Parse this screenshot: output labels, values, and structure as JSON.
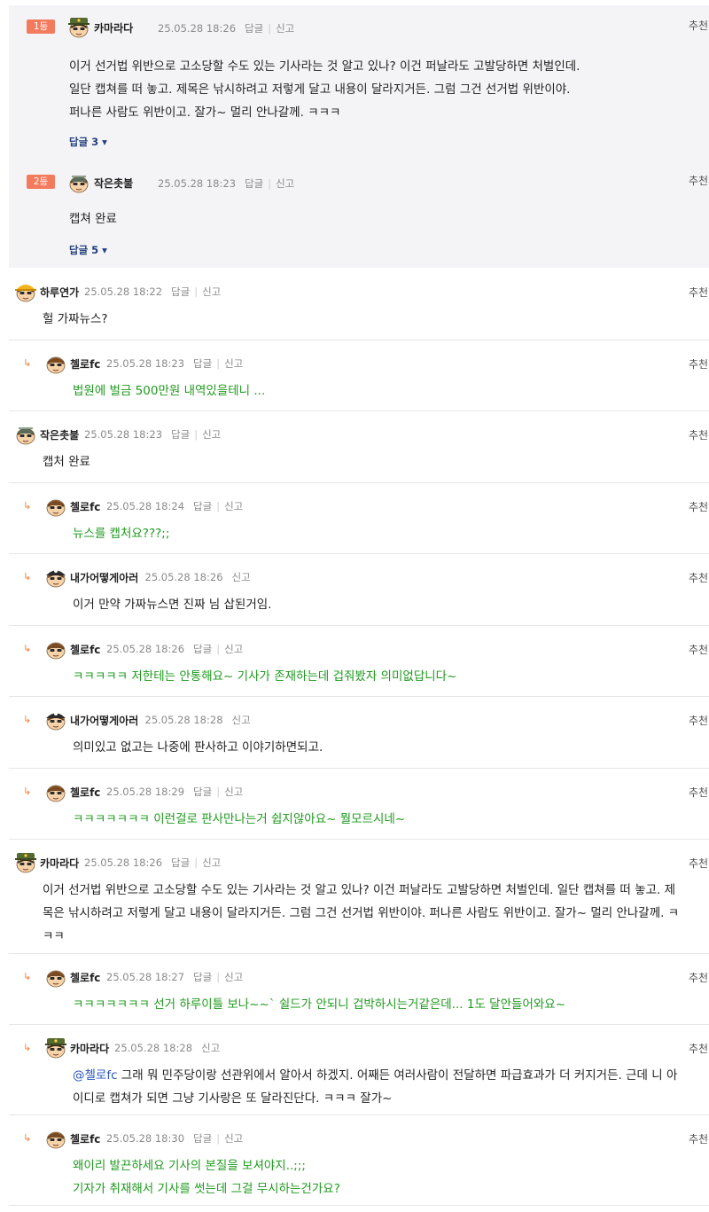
{
  "best_comments": [
    {
      "rank": "1등",
      "nickname": "카마라다",
      "date": "25.05.28 18:26",
      "reply_label": "답글",
      "report_label": "신고",
      "recommend_label": "추천",
      "lines": [
        "이거 선거법 위반으로 고소당할 수도 있는 기사라는 것 알고 있나? 이건 퍼날라도 고발당하면 처벌인데.",
        "일단 캡쳐를 떠 놓고. 제목은 낚시하려고 저렇게 달고 내용이 달라지거든. 그럼 그건 선거법 위반이야.",
        "퍼나른 사람도 위반이고. 잘가~ 멀리 안나갈께. ㅋㅋㅋ"
      ],
      "replies_toggle": "답글 3"
    },
    {
      "rank": "2등",
      "nickname": "작은촛불",
      "date": "25.05.28 18:23",
      "reply_label": "답글",
      "report_label": "신고",
      "recommend_label": "추천",
      "lines": [
        "캡쳐 완료"
      ],
      "replies_toggle": "답글 5"
    }
  ],
  "comments": [
    {
      "reply": false,
      "avatar": "yellow-hat",
      "nickname": "하루연가",
      "date": "25.05.28 18:22",
      "has_reply": true,
      "reply_label": "답글",
      "report_label": "신고",
      "recommend_label": "추천",
      "green": false,
      "lines": [
        "헐 가짜뉴스?"
      ]
    },
    {
      "reply": true,
      "avatar": "brown-hair",
      "nickname": "첼로fc",
      "date": "25.05.28 18:23",
      "has_reply": true,
      "reply_label": "답글",
      "report_label": "신고",
      "recommend_label": "추천",
      "green": true,
      "lines": [
        "법원에 벌금 500만원 내역있을테니 ..."
      ]
    },
    {
      "reply": false,
      "avatar": "helmet",
      "nickname": "작은촛불",
      "date": "25.05.28 18:23",
      "has_reply": true,
      "reply_label": "답글",
      "report_label": "신고",
      "recommend_label": "추천",
      "green": false,
      "lines": [
        "캡처 완료"
      ]
    },
    {
      "reply": true,
      "avatar": "brown-hair",
      "nickname": "첼로fc",
      "date": "25.05.28 18:24",
      "has_reply": true,
      "reply_label": "답글",
      "report_label": "신고",
      "recommend_label": "추천",
      "green": true,
      "lines": [
        "뉴스를 캡처요???;;"
      ]
    },
    {
      "reply": true,
      "avatar": "pirate",
      "nickname": "내가어떻게아러",
      "date": "25.05.28 18:26",
      "has_reply": false,
      "reply_label": "",
      "report_label": "신고",
      "recommend_label": "추천",
      "green": false,
      "lines": [
        "이거 만약 가짜뉴스면 진짜 님 삽된거임."
      ]
    },
    {
      "reply": true,
      "avatar": "brown-hair",
      "nickname": "첼로fc",
      "date": "25.05.28 18:26",
      "has_reply": true,
      "reply_label": "답글",
      "report_label": "신고",
      "recommend_label": "추천",
      "green": true,
      "lines": [
        "ㅋㅋㅋㅋㅋ 저한테는 안통해요~ 기사가 존재하는데 겁줘봤자 의미없답니다~"
      ]
    },
    {
      "reply": true,
      "avatar": "pirate",
      "nickname": "내가어떻게아러",
      "date": "25.05.28 18:28",
      "has_reply": false,
      "reply_label": "",
      "report_label": "신고",
      "recommend_label": "추천",
      "green": false,
      "lines": [
        "의미있고 없고는 나중에 판사하고 이야기하면되고."
      ]
    },
    {
      "reply": true,
      "avatar": "brown-hair",
      "nickname": "첼로fc",
      "date": "25.05.28 18:29",
      "has_reply": true,
      "reply_label": "답글",
      "report_label": "신고",
      "recommend_label": "추천",
      "green": true,
      "lines": [
        "ㅋㅋㅋㅋㅋㅋㅋ 이런걸로 판사만나는거 쉽지않아요~ 뭘모르시네~"
      ]
    },
    {
      "reply": false,
      "avatar": "military",
      "nickname": "카마라다",
      "date": "25.05.28 18:26",
      "has_reply": true,
      "reply_label": "답글",
      "report_label": "신고",
      "recommend_label": "추천",
      "green": false,
      "lines": [
        "이거 선거법 위반으로 고소당할 수도 있는 기사라는 것 알고 있나? 이건 퍼날라도 고발당하면 처벌인데. 일단 캡쳐를 떠 놓고. 제",
        "목은 낚시하려고 저렇게 달고 내용이 달라지거든. 그럼 그건 선거법 위반이야. 퍼나른 사람도 위반이고. 잘가~ 멀리 안나갈께. ㅋ",
        "ㅋㅋ"
      ]
    },
    {
      "reply": true,
      "avatar": "brown-hair",
      "nickname": "첼로fc",
      "date": "25.05.28 18:27",
      "has_reply": true,
      "reply_label": "답글",
      "report_label": "신고",
      "recommend_label": "추천",
      "green": true,
      "lines": [
        "ㅋㅋㅋㅋㅋㅋㅋ 선거 하루이틀 보나~~` 쉴드가 안되니 겁박하시는거같은데... 1도 달안들어와요~"
      ]
    },
    {
      "reply": true,
      "avatar": "military",
      "nickname": "카마라다",
      "date": "25.05.28 18:28",
      "has_reply": false,
      "reply_label": "",
      "report_label": "신고",
      "recommend_label": "추천",
      "green": false,
      "mention": "@첼로fc",
      "lines": [
        " 그래 뭐 민주당이랑 선관위에서 알아서 하겠지. 어째든 여러사람이 전달하면 파급효과가 더 커지거든. 근데 니 아",
        "이디로 캡쳐가 되면 그냥 기사랑은 또 달라진단다. ㅋㅋㅋ 잘가~"
      ]
    },
    {
      "reply": true,
      "avatar": "brown-hair",
      "nickname": "첼로fc",
      "date": "25.05.28 18:30",
      "has_reply": true,
      "reply_label": "답글",
      "report_label": "신고",
      "recommend_label": "추천",
      "green": true,
      "lines": [
        "왜이리 발끈하세요 기사의 본질을 보셔야지..;;;",
        "기자가 취재해서 기사를 썻는데 그걸 무시하는건가요?"
      ]
    }
  ]
}
